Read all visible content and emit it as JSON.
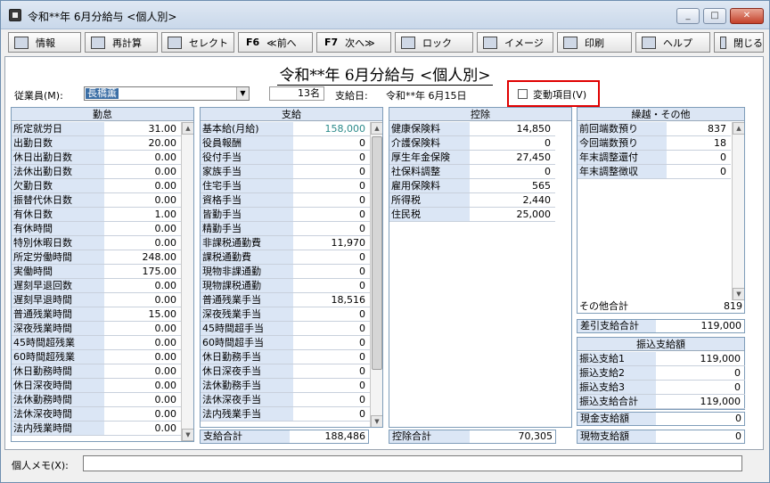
{
  "window": {
    "title": "令和**年 6月分給与 <個人別>",
    "min": "_",
    "max": "□",
    "close": "✕"
  },
  "toolbar": [
    {
      "name": "info",
      "icon": "info-icon",
      "label": "情報"
    },
    {
      "name": "recalc",
      "icon": "calculator-icon",
      "label": "再計算"
    },
    {
      "name": "select",
      "icon": "select-icon",
      "label": "セレクト"
    },
    {
      "name": "prev",
      "key": "F6",
      "label": "≪前へ"
    },
    {
      "name": "next",
      "key": "F7",
      "label": "次へ≫"
    },
    {
      "name": "lock",
      "icon": "key-icon",
      "label": "ロック"
    },
    {
      "name": "image",
      "icon": "monitor-icon",
      "label": "イメージ"
    },
    {
      "name": "print",
      "icon": "printer-icon",
      "label": "印刷"
    },
    {
      "name": "help",
      "icon": "help-icon",
      "label": "ヘルプ"
    },
    {
      "name": "close",
      "icon": "exit-door-icon",
      "label": "閉じる"
    }
  ],
  "page_title": "令和**年 6月分給与 <個人別>",
  "employee": {
    "label": "従業員(M):",
    "value": "長橋薫",
    "count": "13名"
  },
  "paydate": {
    "label": "支給日:",
    "value": "令和**年 6月15日"
  },
  "variable": {
    "label": "変動項目(V)",
    "checked": false
  },
  "kintai": {
    "header": "勤怠",
    "rows": [
      {
        "label": "所定就労日",
        "value": "31.00"
      },
      {
        "label": "出勤日数",
        "value": "20.00"
      },
      {
        "label": "休日出勤日数",
        "value": "0.00"
      },
      {
        "label": "法休出勤日数",
        "value": "0.00"
      },
      {
        "label": "欠勤日数",
        "value": "0.00"
      },
      {
        "label": "振替代休日数",
        "value": "0.00"
      },
      {
        "label": "有休日数",
        "value": "1.00"
      },
      {
        "label": "有休時間",
        "value": "0.00"
      },
      {
        "label": "特別休暇日数",
        "value": "0.00"
      },
      {
        "label": "所定労働時間",
        "value": "248.00"
      },
      {
        "label": "実働時間",
        "value": "175.00"
      },
      {
        "label": "遅刻早退回数",
        "value": "0.00"
      },
      {
        "label": "遅刻早退時間",
        "value": "0.00"
      },
      {
        "label": "普通残業時間",
        "value": "15.00"
      },
      {
        "label": "深夜残業時間",
        "value": "0.00"
      },
      {
        "label": "45時間超残業",
        "value": "0.00"
      },
      {
        "label": "60時間超残業",
        "value": "0.00"
      },
      {
        "label": "休日勤務時間",
        "value": "0.00"
      },
      {
        "label": "休日深夜時間",
        "value": "0.00"
      },
      {
        "label": "法休勤務時間",
        "value": "0.00"
      },
      {
        "label": "法休深夜時間",
        "value": "0.00"
      },
      {
        "label": "法内残業時間",
        "value": "0.00"
      }
    ]
  },
  "shikyu": {
    "header": "支給",
    "rows": [
      {
        "label": "基本給(月給)",
        "value": "158,000",
        "accent": "#2a8a8a"
      },
      {
        "label": "役員報酬",
        "value": "0"
      },
      {
        "label": "役付手当",
        "value": "0"
      },
      {
        "label": "家族手当",
        "value": "0"
      },
      {
        "label": "住宅手当",
        "value": "0"
      },
      {
        "label": "資格手当",
        "value": "0"
      },
      {
        "label": "皆勤手当",
        "value": "0"
      },
      {
        "label": "精勤手当",
        "value": "0"
      },
      {
        "label": "非課税通勤費",
        "value": "11,970"
      },
      {
        "label": "課税通勤費",
        "value": "0"
      },
      {
        "label": "現物非課通勤",
        "value": "0"
      },
      {
        "label": "現物課税通勤",
        "value": "0"
      },
      {
        "label": "普通残業手当",
        "value": "18,516"
      },
      {
        "label": "深夜残業手当",
        "value": "0"
      },
      {
        "label": "45時間超手当",
        "value": "0"
      },
      {
        "label": "60時間超手当",
        "value": "0"
      },
      {
        "label": "休日勤務手当",
        "value": "0"
      },
      {
        "label": "休日深夜手当",
        "value": "0"
      },
      {
        "label": "法休勤務手当",
        "value": "0"
      },
      {
        "label": "法休深夜手当",
        "value": "0"
      },
      {
        "label": "法内残業手当",
        "value": "0"
      }
    ],
    "total_label": "支給合計",
    "total": "188,486"
  },
  "kojo": {
    "header": "控除",
    "rows": [
      {
        "label": "健康保険料",
        "value": "14,850"
      },
      {
        "label": "介護保険料",
        "value": "0"
      },
      {
        "label": "厚生年金保険",
        "value": "27,450"
      },
      {
        "label": "社保料調整",
        "value": "0"
      },
      {
        "label": "雇用保険料",
        "value": "565"
      },
      {
        "label": "所得税",
        "value": "2,440"
      },
      {
        "label": "住民税",
        "value": "25,000"
      }
    ],
    "total_label": "控除合計",
    "total": "70,305"
  },
  "kurikoshi": {
    "header": "繰越・その他",
    "rows": [
      {
        "label": "前回端数預り",
        "value": "837"
      },
      {
        "label": "今回端数預り",
        "value": "18"
      },
      {
        "label": "年末調整還付",
        "value": "0"
      },
      {
        "label": "年末調整徴収",
        "value": "0"
      }
    ],
    "other_label": "その他合計",
    "other": "819"
  },
  "net": {
    "label": "差引支給合計",
    "value": "119,000"
  },
  "furikomi": {
    "header": "振込支給額",
    "rows": [
      {
        "label": "振込支給1",
        "value": "119,000"
      },
      {
        "label": "振込支給2",
        "value": "0"
      },
      {
        "label": "振込支給3",
        "value": "0"
      },
      {
        "label": "振込支給合計",
        "value": "119,000"
      }
    ]
  },
  "cash": {
    "label": "現金支給額",
    "value": "0"
  },
  "inkind": {
    "label": "現物支給額",
    "value": "0"
  },
  "memo": {
    "label": "個人メモ(X):",
    "value": ""
  }
}
